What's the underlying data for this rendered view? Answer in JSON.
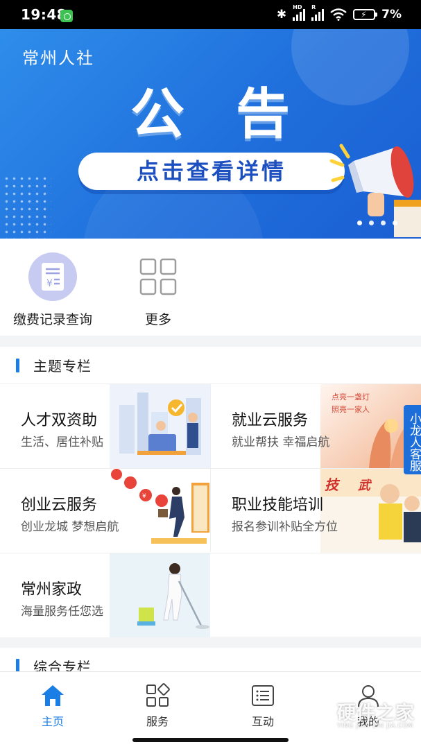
{
  "status_bar": {
    "time": "19:48",
    "battery_pct": "7%",
    "bluetooth": "bluetooth-icon",
    "signal1_label": "HD",
    "signal2_label": "R"
  },
  "banner": {
    "brand": "常州人社",
    "headline": "公告",
    "cta": "点击查看详情",
    "slides": 4,
    "active_slide": 1
  },
  "quick_actions": [
    {
      "label": "缴费记录查询",
      "icon": "receipt-icon"
    },
    {
      "label": "更多",
      "icon": "grid-icon"
    }
  ],
  "topic_section": {
    "title": "主题专栏",
    "cards": [
      {
        "title": "人才双资助",
        "subtitle": "生活、居住补贴"
      },
      {
        "title": "就业云服务",
        "subtitle": "就业帮扶 幸福启航"
      },
      {
        "title": "创业云服务",
        "subtitle": "创业龙城 梦想启航"
      },
      {
        "title": "职业技能培训",
        "subtitle": "报名参训补贴全方位"
      },
      {
        "title": "常州家政",
        "subtitle": "海量服务任您选"
      }
    ]
  },
  "second_section": {
    "title": "综合专栏"
  },
  "side_badge": "小龙人客服",
  "tabs": [
    {
      "label": "主页",
      "icon": "home-icon",
      "active": true
    },
    {
      "label": "服务",
      "icon": "services-grid-icon",
      "active": false
    },
    {
      "label": "互动",
      "icon": "chat-list-icon",
      "active": false
    },
    {
      "label": "我的",
      "icon": "profile-icon",
      "active": false
    }
  ],
  "watermark": {
    "name": "硬件之家",
    "pinyin": "YING JIAN ZHI JIA.COM"
  },
  "colors": {
    "accent": "#1b7ee5",
    "banner": "#1f6fdc",
    "quick_icon_bg": "#c7cbf2"
  }
}
